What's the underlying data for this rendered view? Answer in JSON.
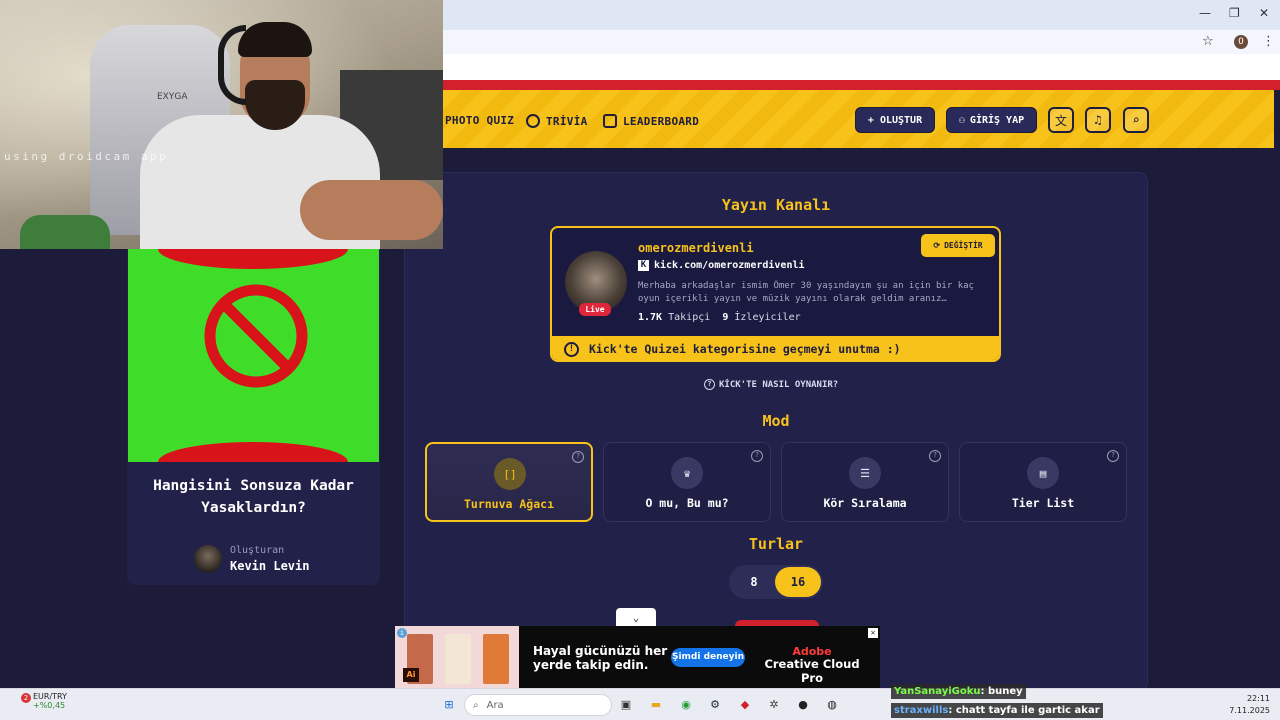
{
  "webcam": {
    "overlay_text": "using droidcam app",
    "chair_brand": "EXYGA"
  },
  "browser": {
    "window_controls": [
      "—",
      "❐",
      "✕"
    ],
    "profile_initial": "O"
  },
  "header": {
    "nav": [
      {
        "label": "PHOTO QUIZ",
        "icon": "photo-icon"
      },
      {
        "label": "TRİVİA",
        "icon": "chat-question-icon"
      },
      {
        "label": "LEADERBOARD",
        "icon": "medal-icon"
      }
    ],
    "create_label": "+ OLUŞTUR",
    "login_label": "GİRİŞ YAP"
  },
  "left_card": {
    "title": "Hangisini Sonsuza Kadar Yasaklardın?",
    "creator_label": "Oluşturan",
    "creator_name": "Kevin Levin"
  },
  "channel": {
    "section_title": "Yayın Kanalı",
    "name": "omerozmerdivenli",
    "link": "kick.com/omerozmerdivenli",
    "description": "Merhaba arkadaşlar ismim Ömer 30 yaşındayım şu an için bir kaç oyun içerikli yayın ve müzik yayını olarak geldim aranız…",
    "followers_value": "1.7K",
    "followers_label": "Takipçi",
    "viewers_value": "9",
    "viewers_label": "İzleyiciler",
    "live_label": "Live",
    "change_label": "DEĞİŞTİR",
    "notice": "Kick'te Quizei kategorisine geçmeyi unutma :)"
  },
  "how_to": "KİCK'TE NASIL OYNANIR?",
  "mode": {
    "title": "Mod",
    "options": [
      {
        "label": "Turnuva Ağacı",
        "icon": "[]",
        "active": true
      },
      {
        "label": "O mu, Bu mu?",
        "icon": "♛",
        "active": false
      },
      {
        "label": "Kör Sıralama",
        "icon": "☰",
        "active": false
      },
      {
        "label": "Tier List",
        "icon": "▤",
        "active": false
      }
    ],
    "help": "?"
  },
  "rounds": {
    "title": "Turlar",
    "options": [
      "8",
      "16"
    ],
    "selected": "16"
  },
  "ad": {
    "headline": "Hayal gücünüzü her yerde takip edin.",
    "cta": "Şimdi deneyin",
    "brand_top": "Adobe",
    "brand_bottom": "Creative Cloud Pro",
    "ai_badge": "Ai"
  },
  "taskbar": {
    "ticker_name": "EUR/TRY",
    "ticker_change": "+%0,45",
    "ticker_badge": "2",
    "search_placeholder": "Ara",
    "time": "22:11",
    "date": "7.11.2025"
  },
  "chat": [
    {
      "user": "YanSanayiGoku",
      "message": ": buney",
      "color": "#7cfc4a"
    },
    {
      "user": "straxwills",
      "message": ": chatt tayfa ile gartic akar",
      "color": "#6ab0ff"
    }
  ]
}
